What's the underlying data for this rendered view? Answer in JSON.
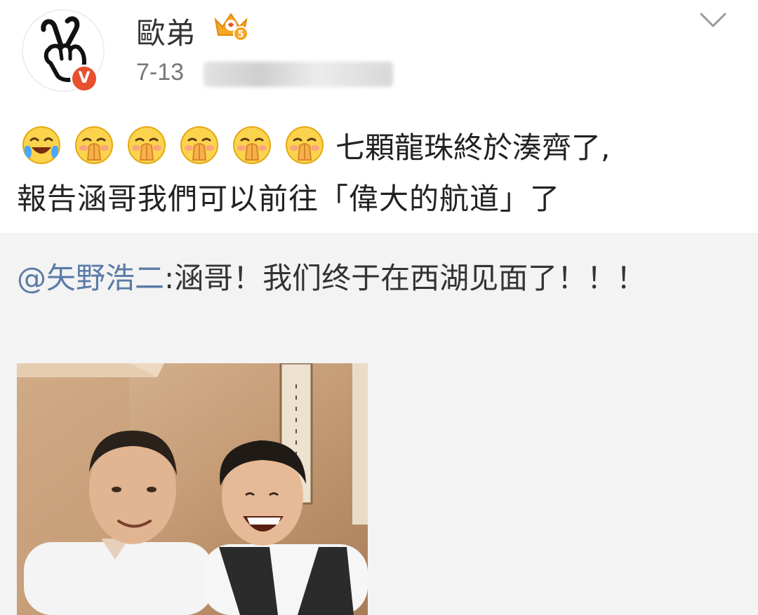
{
  "post": {
    "username": "歐弟",
    "timestamp": "7-13",
    "text_line1": "七顆龍珠終於湊齊了,",
    "text_line2": "報告涵哥我們可以前往「偉大的航道」了",
    "emojis": [
      "laughing-crying-emoji",
      "hand-over-mouth-emoji",
      "hand-over-mouth-emoji",
      "hand-over-mouth-emoji",
      "hand-over-mouth-emoji",
      "hand-over-mouth-emoji"
    ]
  },
  "badges": {
    "verified_mark": "V",
    "vip_level": "5"
  },
  "repost": {
    "mention": "@矢野浩二",
    "text": ":涵哥！我们终于在西湖见面了！！！"
  },
  "colors": {
    "mention": "#5b7ba8",
    "verified_badge": "#e8502f",
    "repost_background": "#f3f3f3"
  }
}
